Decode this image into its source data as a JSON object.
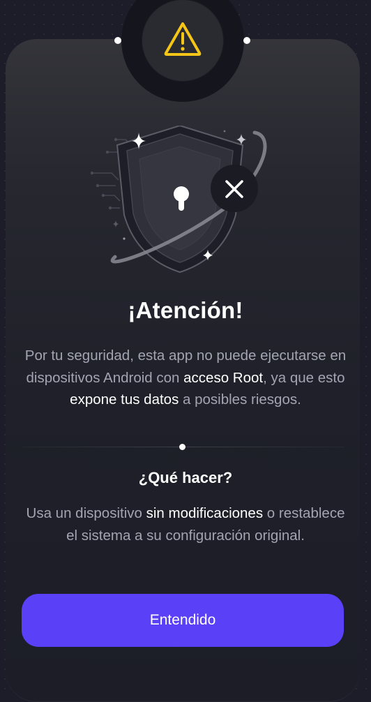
{
  "alert": {
    "icon": "warning-triangle-icon",
    "accent_color": "#f5c518"
  },
  "hero": {
    "icon": "shield-keyhole-icon",
    "badge_icon": "close-icon"
  },
  "title": "¡Atención!",
  "message": {
    "part1": "Por tu seguridad, esta app no puede ejecutarse en dispositivos Android con ",
    "highlight1": "acceso Root",
    "part2": ", ya que esto ",
    "highlight2": "expone tus datos",
    "part3": " a posibles riesgos."
  },
  "what_to_do": {
    "title": "¿Qué hacer?",
    "part1": "Usa un dispositivo ",
    "highlight": "sin modificaciones",
    "part2": " o restablece el sistema a su configuración original."
  },
  "button": {
    "label": "Entendido",
    "color": "#5a41f7"
  }
}
